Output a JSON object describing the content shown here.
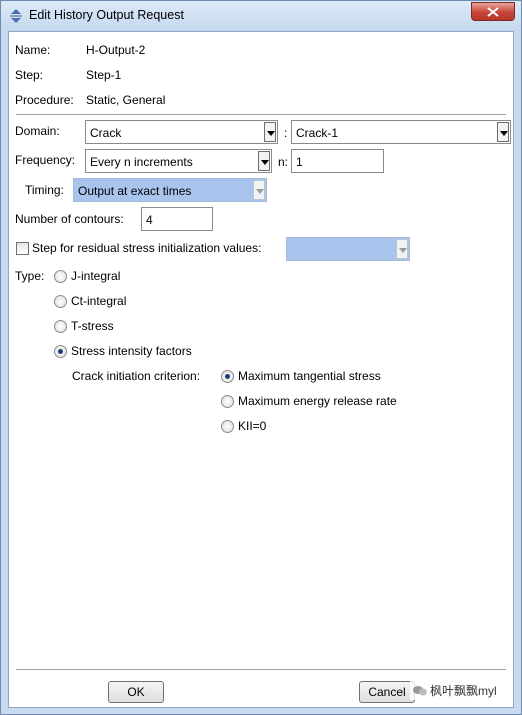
{
  "window": {
    "title": "Edit History Output Request",
    "close_label": "×"
  },
  "info": {
    "name_label": "Name:",
    "name_value": "H-Output-2",
    "step_label": "Step:",
    "step_value": "Step-1",
    "procedure_label": "Procedure:",
    "procedure_value": "Static, General"
  },
  "domain": {
    "label": "Domain:",
    "type_value": "Crack",
    "separator": ":",
    "target_value": "Crack-1"
  },
  "frequency": {
    "label": "Frequency:",
    "value": "Every n increments",
    "n_label": "n:",
    "n_value": "1"
  },
  "timing": {
    "label": "Timing:",
    "value": "Output at exact times"
  },
  "contours": {
    "label": "Number of contours:",
    "value": "4"
  },
  "residual": {
    "label": "Step for residual stress initialization values:",
    "checked": false,
    "value": ""
  },
  "type": {
    "label": "Type:",
    "options": [
      {
        "label": "J-integral",
        "checked": false
      },
      {
        "label": "Ct-integral",
        "checked": false
      },
      {
        "label": "T-stress",
        "checked": false
      },
      {
        "label": "Stress intensity factors",
        "checked": true
      }
    ]
  },
  "criterion": {
    "label": "Crack initiation criterion:",
    "options": [
      {
        "label": "Maximum tangential stress",
        "checked": true
      },
      {
        "label": "Maximum energy release rate",
        "checked": false
      },
      {
        "label": "KII=0",
        "checked": false
      }
    ]
  },
  "buttons": {
    "ok": "OK",
    "cancel": "Cancel"
  },
  "watermark": "枫叶飘飘myl",
  "colors": {
    "disabled_field": "#a8c4ec",
    "window_frame": "#c9daf0",
    "close_button": "#c7453a"
  }
}
